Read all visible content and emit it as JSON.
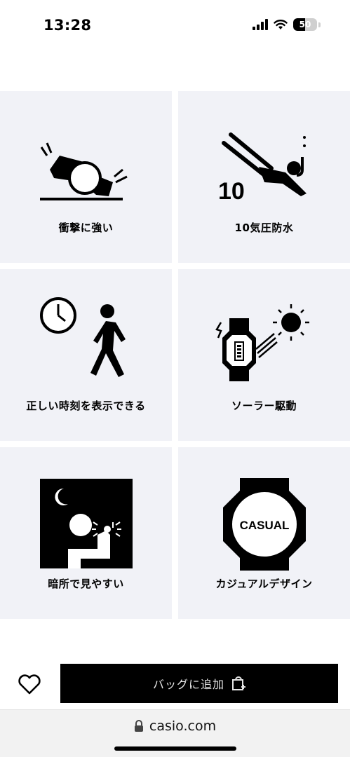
{
  "status_bar": {
    "time": "13:28",
    "battery_level": "50",
    "icons": [
      "cellular-signal-icon",
      "wifi-icon",
      "battery-icon"
    ]
  },
  "features": [
    {
      "label": "衝撃に強い",
      "icon": "shock-resist-icon"
    },
    {
      "label": "10気圧防水",
      "icon": "water-resist-icon",
      "icon_text": "10"
    },
    {
      "label": "正しい時刻を表示できる",
      "icon": "accurate-time-icon"
    },
    {
      "label": "ソーラー駆動",
      "icon": "solar-power-icon"
    },
    {
      "label": "暗所で見やすい",
      "icon": "backlight-icon"
    },
    {
      "label": "カジュアルデザイン",
      "icon": "casual-design-icon",
      "icon_text": "CASUAL"
    }
  ],
  "bottom_bar": {
    "add_to_bag_label": "バッグに追加",
    "favorite_icon": "heart-icon",
    "bag_icon": "bag-add-icon"
  },
  "browser": {
    "url": "casio.com",
    "lock_icon": "lock-icon"
  },
  "colors": {
    "tile_background": "#f1f2f7",
    "button_background": "#000000",
    "button_text": "#e6e6e6"
  }
}
